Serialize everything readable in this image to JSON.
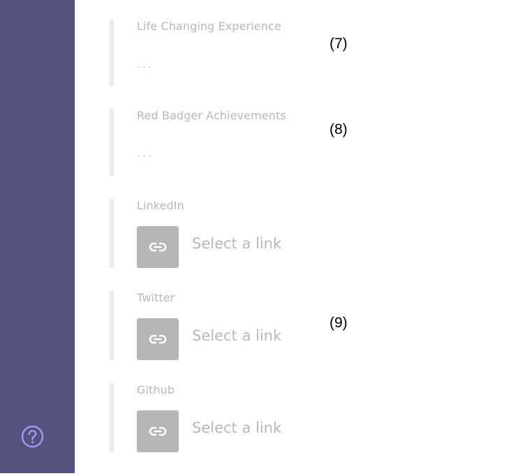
{
  "sidebar": {
    "background": "#55527f",
    "help_icon": "question-circle-icon"
  },
  "fields": [
    {
      "label": "Life Changing Experience",
      "value": "..."
    },
    {
      "label": "Red Badger Achievements",
      "value": "..."
    },
    {
      "label": "LinkedIn",
      "link_placeholder": "Select a link",
      "icon": "link-icon"
    },
    {
      "label": "Twitter",
      "link_placeholder": "Select a link",
      "icon": "link-icon"
    },
    {
      "label": "Github",
      "link_placeholder": "Select a link",
      "icon": "link-icon"
    }
  ],
  "annotations": [
    "(7)",
    "(8)",
    "(9)"
  ]
}
